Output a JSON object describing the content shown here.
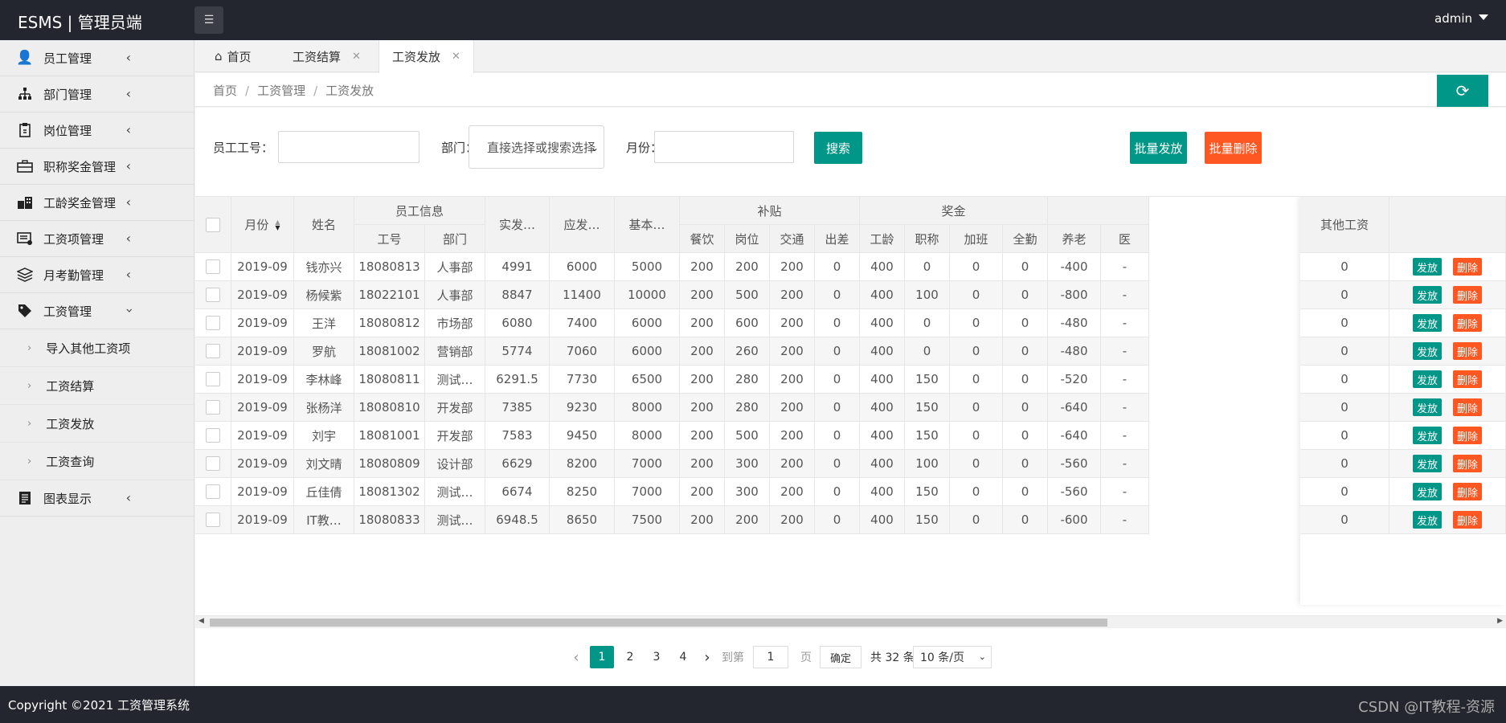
{
  "header": {
    "logo": "ESMS | 管理员端",
    "user": "admin"
  },
  "sidebar": {
    "items": [
      {
        "label": "员工管理",
        "icon": "users-icon"
      },
      {
        "label": "部门管理",
        "icon": "sitemap-icon"
      },
      {
        "label": "岗位管理",
        "icon": "clipboard-icon"
      },
      {
        "label": "职称奖金管理",
        "icon": "briefcase-icon"
      },
      {
        "label": "工龄奖金管理",
        "icon": "building-icon"
      },
      {
        "label": "工资项管理",
        "icon": "list-icon"
      },
      {
        "label": "月考勤管理",
        "icon": "layers-icon"
      },
      {
        "label": "工资管理",
        "icon": "tag-icon"
      }
    ],
    "subitems": [
      "导入其他工资项",
      "工资结算",
      "工资发放",
      "工资查询"
    ],
    "last_item": {
      "label": "图表显示",
      "icon": "report-icon"
    }
  },
  "tabs": [
    {
      "label": "首页"
    },
    {
      "label": "工资结算"
    },
    {
      "label": "工资发放"
    }
  ],
  "breadcrumb": [
    "首页",
    "工资管理",
    "工资发放"
  ],
  "search": {
    "emp_no_label": "员工工号：",
    "dept_label": "部门：",
    "dept_select": "直接选择或搜索选择",
    "month_label": "月份：",
    "search_button": "搜索",
    "batch_issue": "批量发放",
    "batch_delete": "批量删除"
  },
  "table": {
    "headers": {
      "month": "月份",
      "name": "姓名",
      "emp_info": "员工信息",
      "emp_no": "工号",
      "dept": "部门",
      "actual": "实发…",
      "payable": "应发…",
      "basic": "基本…",
      "subsidy": "补贴",
      "meal": "餐饮",
      "post": "岗位",
      "traffic": "交通",
      "trip": "出差",
      "bonus": "奖金",
      "seniority": "工龄",
      "title": "职称",
      "overtime": "加班",
      "attendance": "全勤",
      "pension": "养老",
      "medical_cut": "医",
      "other": "其他工资"
    },
    "rows": [
      {
        "month": "2019-09",
        "name": "钱亦兴",
        "emp_no": "18080813",
        "dept": "人事部",
        "actual": "4991",
        "payable": "6000",
        "basic": "5000",
        "meal": "200",
        "post": "200",
        "traffic": "200",
        "trip": "0",
        "seniority": "400",
        "title": "0",
        "overtime": "0",
        "attendance": "0",
        "pension": "-400",
        "medical": "-",
        "other": "0"
      },
      {
        "month": "2019-09",
        "name": "杨候紫",
        "emp_no": "18022101",
        "dept": "人事部",
        "actual": "8847",
        "payable": "11400",
        "basic": "10000",
        "meal": "200",
        "post": "500",
        "traffic": "200",
        "trip": "0",
        "seniority": "400",
        "title": "100",
        "overtime": "0",
        "attendance": "0",
        "pension": "-800",
        "medical": "-",
        "other": "0"
      },
      {
        "month": "2019-09",
        "name": "王洋",
        "emp_no": "18080812",
        "dept": "市场部",
        "actual": "6080",
        "payable": "7400",
        "basic": "6000",
        "meal": "200",
        "post": "600",
        "traffic": "200",
        "trip": "0",
        "seniority": "400",
        "title": "0",
        "overtime": "0",
        "attendance": "0",
        "pension": "-480",
        "medical": "-",
        "other": "0"
      },
      {
        "month": "2019-09",
        "name": "罗航",
        "emp_no": "18081002",
        "dept": "营销部",
        "actual": "5774",
        "payable": "7060",
        "basic": "6000",
        "meal": "200",
        "post": "260",
        "traffic": "200",
        "trip": "0",
        "seniority": "400",
        "title": "0",
        "overtime": "0",
        "attendance": "0",
        "pension": "-480",
        "medical": "-",
        "other": "0"
      },
      {
        "month": "2019-09",
        "name": "李林峰",
        "emp_no": "18080811",
        "dept": "测试…",
        "actual": "6291.5",
        "payable": "7730",
        "basic": "6500",
        "meal": "200",
        "post": "280",
        "traffic": "200",
        "trip": "0",
        "seniority": "400",
        "title": "150",
        "overtime": "0",
        "attendance": "0",
        "pension": "-520",
        "medical": "-",
        "other": "0"
      },
      {
        "month": "2019-09",
        "name": "张杨洋",
        "emp_no": "18080810",
        "dept": "开发部",
        "actual": "7385",
        "payable": "9230",
        "basic": "8000",
        "meal": "200",
        "post": "280",
        "traffic": "200",
        "trip": "0",
        "seniority": "400",
        "title": "150",
        "overtime": "0",
        "attendance": "0",
        "pension": "-640",
        "medical": "-",
        "other": "0"
      },
      {
        "month": "2019-09",
        "name": "刘宇",
        "emp_no": "18081001",
        "dept": "开发部",
        "actual": "7583",
        "payable": "9450",
        "basic": "8000",
        "meal": "200",
        "post": "500",
        "traffic": "200",
        "trip": "0",
        "seniority": "400",
        "title": "150",
        "overtime": "0",
        "attendance": "0",
        "pension": "-640",
        "medical": "-",
        "other": "0"
      },
      {
        "month": "2019-09",
        "name": "刘文晴",
        "emp_no": "18080809",
        "dept": "设计部",
        "actual": "6629",
        "payable": "8200",
        "basic": "7000",
        "meal": "200",
        "post": "300",
        "traffic": "200",
        "trip": "0",
        "seniority": "400",
        "title": "100",
        "overtime": "0",
        "attendance": "0",
        "pension": "-560",
        "medical": "-",
        "other": "0"
      },
      {
        "month": "2019-09",
        "name": "丘佳倩",
        "emp_no": "18081302",
        "dept": "测试…",
        "actual": "6674",
        "payable": "8250",
        "basic": "7000",
        "meal": "200",
        "post": "300",
        "traffic": "200",
        "trip": "0",
        "seniority": "400",
        "title": "150",
        "overtime": "0",
        "attendance": "0",
        "pension": "-560",
        "medical": "-",
        "other": "0"
      },
      {
        "month": "2019-09",
        "name": "IT教…",
        "emp_no": "18080833",
        "dept": "测试…",
        "actual": "6948.5",
        "payable": "8650",
        "basic": "7500",
        "meal": "200",
        "post": "200",
        "traffic": "200",
        "trip": "0",
        "seniority": "400",
        "title": "150",
        "overtime": "0",
        "attendance": "0",
        "pension": "-600",
        "medical": "-",
        "other": "0"
      }
    ],
    "issue_button": "发放",
    "delete_button": "删除"
  },
  "pagination": {
    "pages": [
      "1",
      "2",
      "3",
      "4"
    ],
    "goto_label": "到第",
    "goto_value": "1",
    "page_unit": "页",
    "confirm": "确定",
    "total": "共 32 条",
    "page_size": "10 条/页"
  },
  "footer": {
    "copyright": "Copyright ©2021 工资管理系统",
    "watermark": "CSDN @IT教程-资源"
  },
  "colors": {
    "primary": "#009688",
    "danger": "#ff5722",
    "header_bg": "#23262e"
  }
}
